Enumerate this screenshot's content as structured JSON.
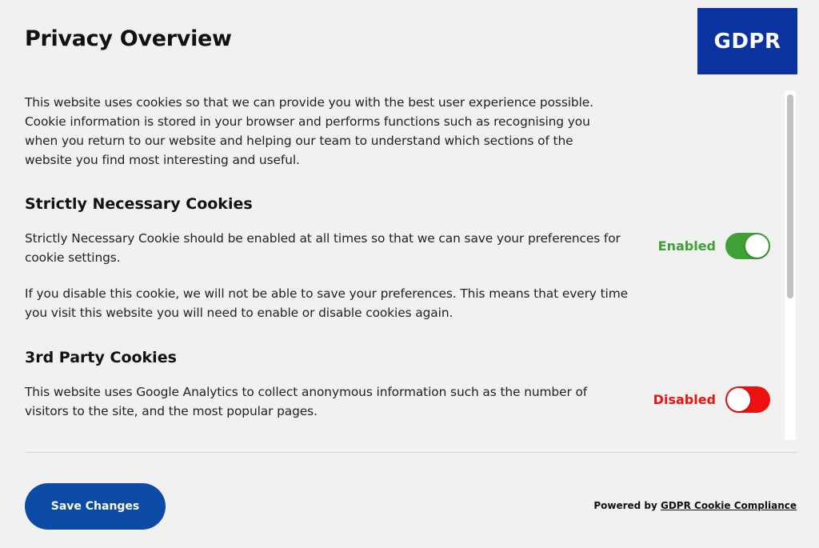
{
  "header": {
    "title": "Privacy Overview",
    "logo_text": "GDPR"
  },
  "intro": {
    "lines": [
      "This website uses cookies so that we can provide you with the best user experience possible.",
      "Cookie information is stored in your browser and performs functions such as recognising you",
      "when you return to our website and helping our team to understand which sections of the",
      "website you find most interesting and useful."
    ]
  },
  "sections": [
    {
      "heading": "Strictly Necessary Cookies",
      "description_lines": [
        "Strictly Necessary Cookie should be enabled at all times so that we can save your preferences for",
        "cookie settings."
      ],
      "extra_lines": [
        "If you disable this cookie, we will not be able to save your preferences. This means that every time",
        "you visit this website you will need to enable or disable cookies again."
      ],
      "toggle_label": "Enabled",
      "toggle_state": "on",
      "toggle_color": "#3ea035"
    },
    {
      "heading": "3rd Party Cookies",
      "description_lines": [
        "This website uses Google Analytics to collect anonymous information such as the number of",
        "visitors to the site, and the most popular pages."
      ],
      "toggle_label": "Disabled",
      "toggle_state": "off",
      "toggle_color": "#ee1111"
    }
  ],
  "footer": {
    "save_label": "Save Changes",
    "powered_prefix": "Powered by",
    "powered_link": "GDPR Cookie Compliance"
  },
  "colors": {
    "brand_blue": "#0a33a0",
    "button_blue": "#0b4aa5",
    "enabled_green": "#3ea035",
    "disabled_red": "#ee1111"
  }
}
